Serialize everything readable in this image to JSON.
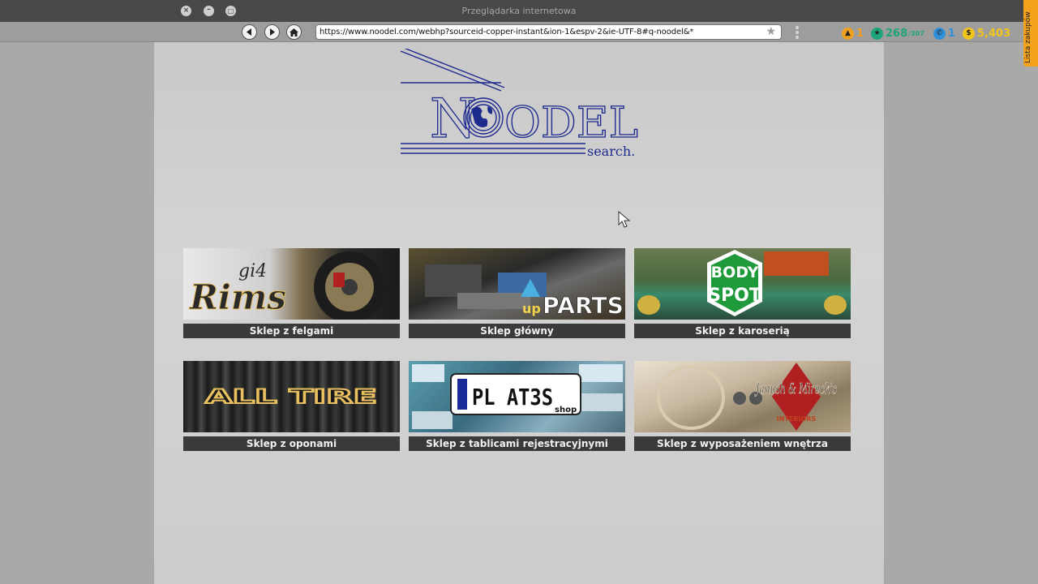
{
  "window": {
    "title": "Przeglądarka internetowa",
    "close": "×",
    "minimize": "–",
    "maximize": "□"
  },
  "toolbar": {
    "url": "https://www.noodel.com/webhp?sourceid-copper-instant&ion-1&espv-2&ie-UTF-8#q-noodel&*",
    "star": "★"
  },
  "stats": {
    "level": "1",
    "reputation": "268",
    "reputation_max": "/307",
    "calls": "1",
    "money": "5,403"
  },
  "side_tab": "Lista zakupów",
  "logo": {
    "brand": "NOODEL",
    "tagline": "search."
  },
  "tiles": [
    {
      "caption": "Sklep z felgami",
      "art_main": "Rims",
      "art_sub": "gi4"
    },
    {
      "caption": "Sklep główny",
      "art_main": "PARTS",
      "art_sub": "up"
    },
    {
      "caption": "Sklep z karoserią",
      "art_main": "SPOT",
      "art_sub": "BODY"
    },
    {
      "caption": "Sklep z oponami",
      "art_main": "ALL TIRE",
      "art_sub": ""
    },
    {
      "caption": "Sklep z tablicami rejestracyjnymi",
      "art_main": "PL AT3S",
      "art_sub": "shop"
    },
    {
      "caption": "Sklep z wyposażeniem wnętrza",
      "art_main": "Janush & Mireck's",
      "art_sub": "INTERIORS"
    }
  ],
  "colors": {
    "logo_blue": "#1d2a8e",
    "accent_orange": "#f3a21c",
    "caption_bg": "#3a3a3a"
  }
}
